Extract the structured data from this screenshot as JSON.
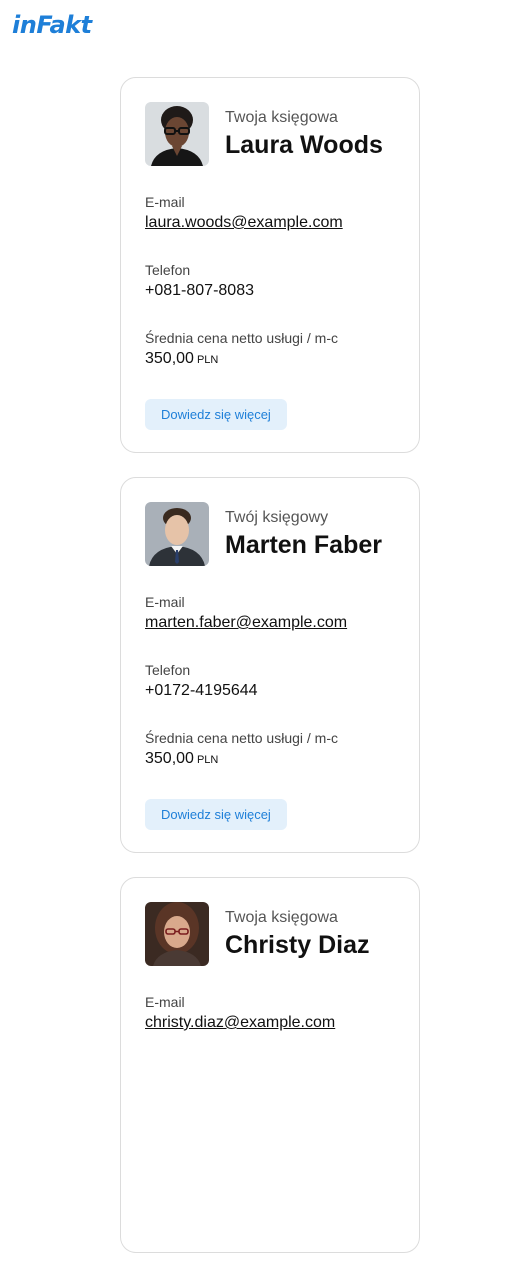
{
  "header": {
    "logo_text": "inFakt"
  },
  "cards": [
    {
      "role": "Twoja księgowa",
      "name": "Laura Woods",
      "avatar": "woman-glasses-avatar",
      "email_label": "E-mail",
      "email": "laura.woods@example.com",
      "phone_label": "Telefon",
      "phone": "+081-807-8083",
      "price_label": "Średnia cena netto usługi / m-c",
      "price": "350,00",
      "currency": "PLN",
      "button_label": "Dowiedz się więcej"
    },
    {
      "role": "Twój księgowy",
      "name": "Marten Faber",
      "avatar": "man-suit-avatar",
      "email_label": "E-mail",
      "email": "marten.faber@example.com",
      "phone_label": "Telefon",
      "phone": "+0172-4195644",
      "price_label": "Średnia cena netto usługi / m-c",
      "price": "350,00",
      "currency": "PLN",
      "button_label": "Dowiedz się więcej"
    },
    {
      "role": "Twoja księgowa",
      "name": "Christy Diaz",
      "avatar": "woman-brown-hair-avatar",
      "email_label": "E-mail",
      "email": "christy.diaz@example.com"
    }
  ],
  "colors": {
    "brand": "#1e7fd8",
    "button_bg": "#e3f0fb",
    "card_border": "#dcdcdc"
  }
}
